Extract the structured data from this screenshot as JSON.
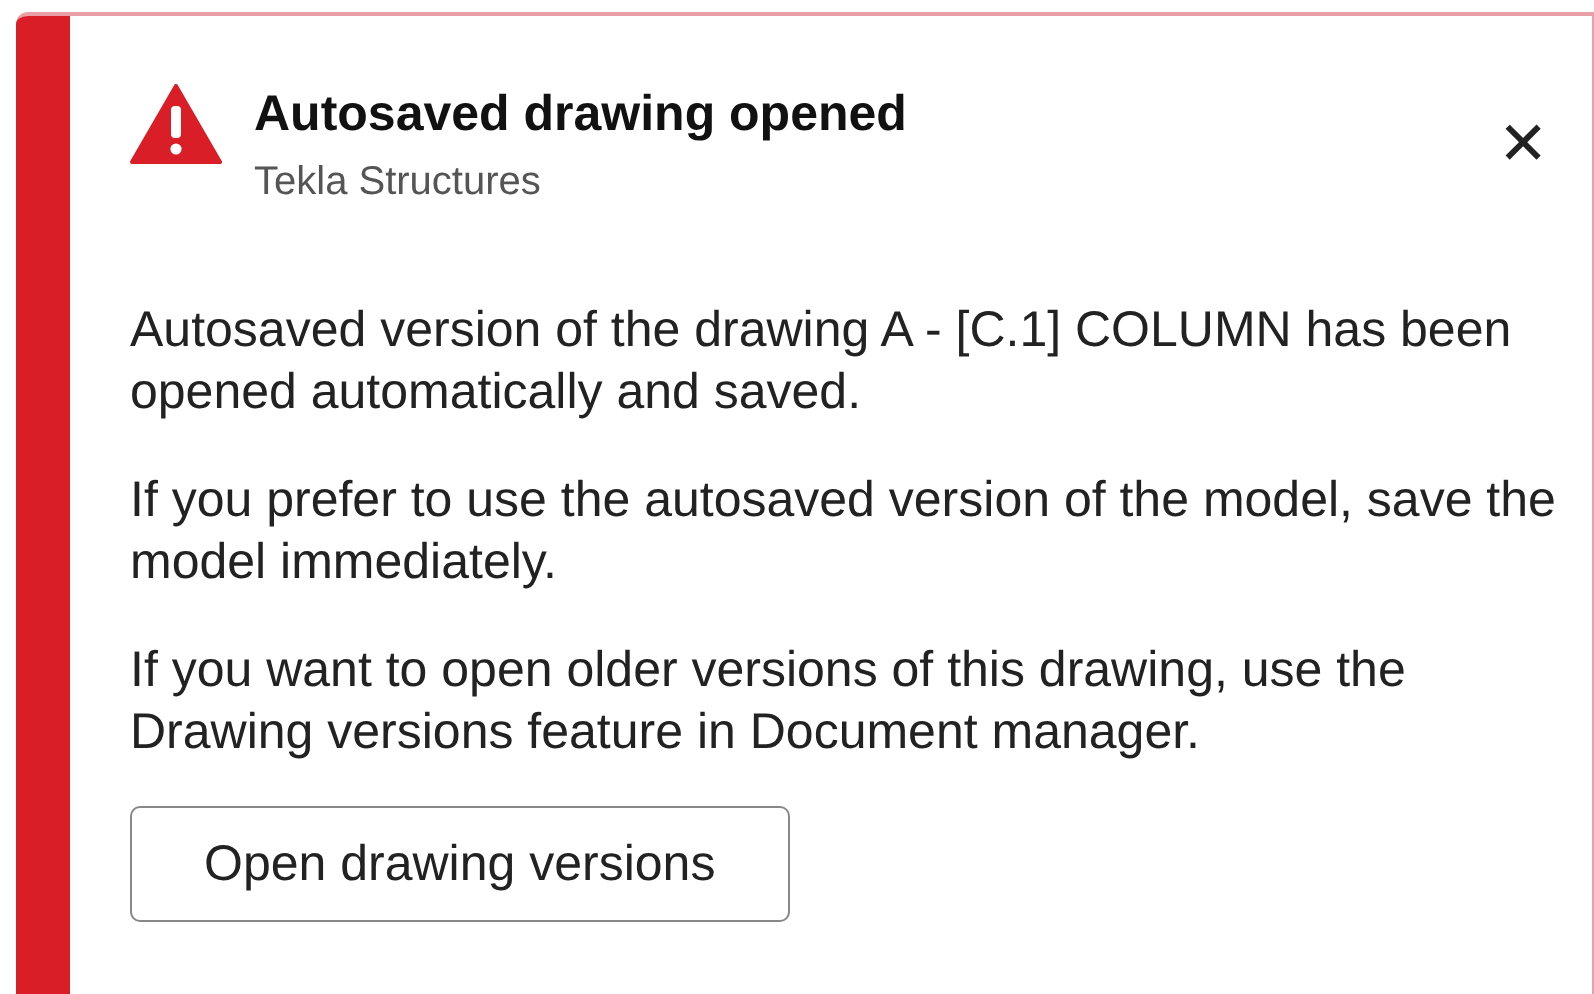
{
  "notification": {
    "color": "#da1e28",
    "title": "Autosaved drawing opened",
    "source": "Tekla Structures",
    "close": "✕",
    "paragraphs": [
      "Autosaved version of the drawing A - [C.1] COLUMN has been opened automatically and saved.",
      "If you prefer to use the autosaved version of the model, save the model immediately.",
      "If you want to open older versions of this drawing, use the Drawing versions feature in Document manager."
    ],
    "button": "Open drawing versions"
  }
}
